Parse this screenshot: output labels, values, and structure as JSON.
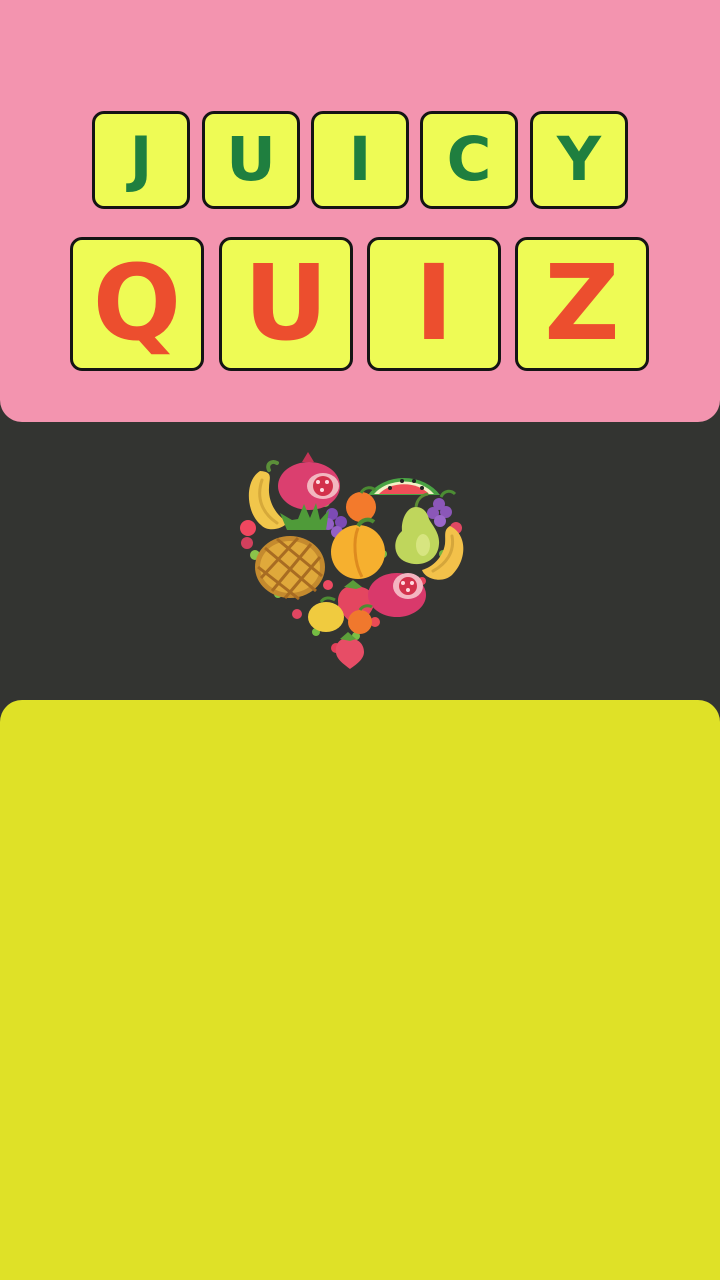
{
  "title": {
    "word_one": [
      "J",
      "U",
      "I",
      "C",
      "Y"
    ],
    "word_two": [
      "Q",
      "U",
      "I",
      "Z"
    ]
  },
  "colors": {
    "top_panel": "#f394af",
    "background": "#333431",
    "tile_fill": "#eefb55",
    "tile_border": "#141414",
    "word_one_text": "#1f7f3f",
    "word_two_text": "#ec4e2e",
    "bottom_panel": "#dfe127"
  },
  "artwork": {
    "icon": "fruit-heart-icon"
  }
}
